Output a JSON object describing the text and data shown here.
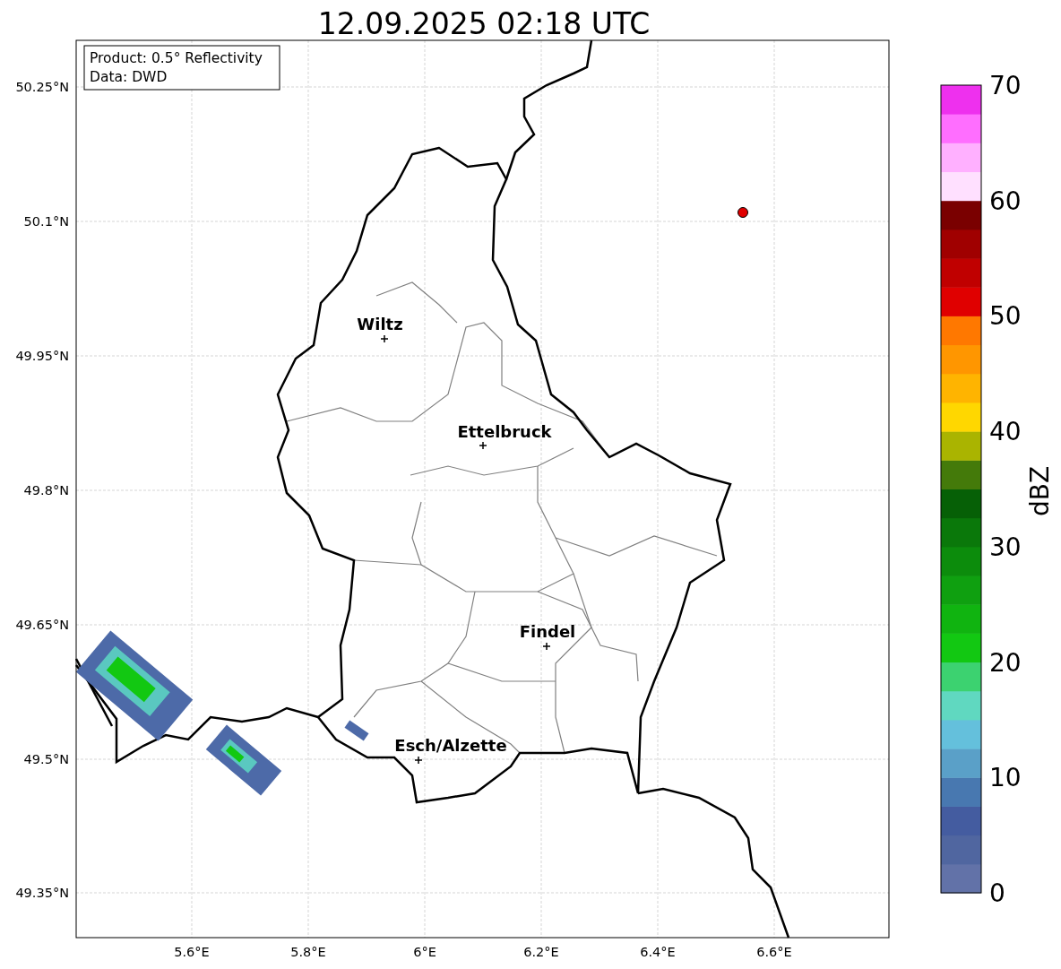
{
  "title": "12.09.2025 02:18 UTC",
  "legend": [
    "Product: 0.5° Reflectivity",
    "Data: DWD"
  ],
  "y_ticks": [
    "50.25°N",
    "50.1°N",
    "49.95°N",
    "49.8°N",
    "49.65°N",
    "49.5°N",
    "49.35°N"
  ],
  "x_ticks": [
    "5.6°E",
    "5.8°E",
    "6°E",
    "6.2°E",
    "6.4°E",
    "6.6°E"
  ],
  "cities": [
    {
      "name": "Wiltz"
    },
    {
      "name": "Ettelbruck"
    },
    {
      "name": "Findel"
    },
    {
      "name": "Esch/Alzette"
    }
  ],
  "colorbar": {
    "label": "dBZ",
    "ticks": [
      "70",
      "60",
      "50",
      "40",
      "30",
      "20",
      "10",
      "0"
    ]
  }
}
